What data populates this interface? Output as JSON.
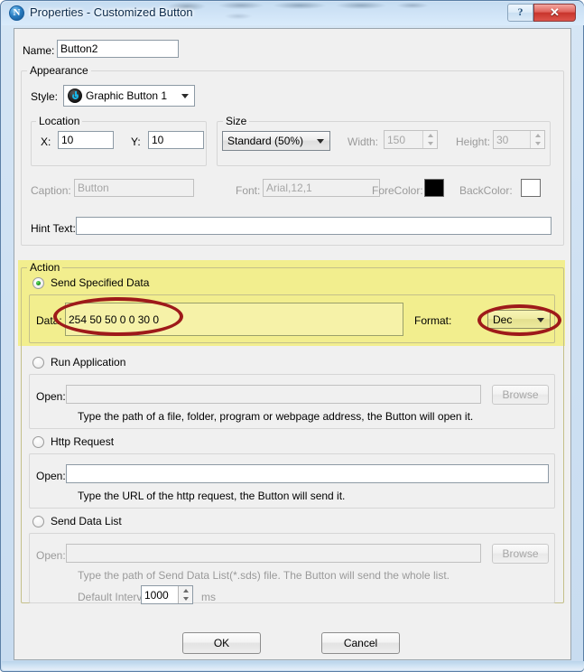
{
  "window": {
    "title": "Properties - Customized Button",
    "icon": "app-n-icon",
    "help_label": "?",
    "close_label": "✕"
  },
  "name_field": {
    "label": "Name:",
    "value": "Button2"
  },
  "appearance": {
    "title": "Appearance",
    "style": {
      "label": "Style:",
      "value": "Graphic Button 1",
      "icon": "power-button-icon"
    },
    "location": {
      "title": "Location",
      "x_label": "X:",
      "x_value": "10",
      "y_label": "Y:",
      "y_value": "10"
    },
    "size": {
      "title": "Size",
      "preset_value": "Standard   (50%)",
      "width_label": "Width:",
      "width_value": "150",
      "height_label": "Height:",
      "height_value": "30"
    },
    "caption": {
      "label": "Caption:",
      "value": "Button"
    },
    "font": {
      "label": "Font:",
      "value": "Arial,12,1"
    },
    "forecolor": {
      "label": "ForeColor:",
      "color": "#000000"
    },
    "backcolor": {
      "label": "BackColor:",
      "color": "#ffffff"
    },
    "hint": {
      "label": "Hint Text:",
      "value": ""
    }
  },
  "action": {
    "title": "Action",
    "highlight_color": "#f2ee8e",
    "annotation_color": "#9e1a1a",
    "send_specified_data": {
      "radio_label": "Send Specified Data",
      "selected": true,
      "data_label": "Data:",
      "data_value": "254 50 50 0 0 30 0",
      "format_label": "Format:",
      "format_value": "Dec"
    },
    "run_application": {
      "radio_label": "Run Application",
      "selected": false,
      "open_label": "Open:",
      "open_value": "",
      "browse_label": "Browse",
      "hint": "Type the path of a file, folder, program or webpage address, the Button will open it."
    },
    "http_request": {
      "radio_label": "Http Request",
      "selected": false,
      "open_label": "Open:",
      "open_value": "",
      "hint": "Type the URL of the http request, the Button will send it."
    },
    "send_data_list": {
      "radio_label": "Send Data List",
      "selected": false,
      "open_label": "Open:",
      "open_value": "",
      "browse_label": "Browse",
      "hint": "Type the path of Send Data List(*.sds) file. The Button will send the whole list.",
      "interval_label": "Default Interval",
      "interval_value": "1000",
      "interval_unit": "ms"
    }
  },
  "footer": {
    "ok_label": "OK",
    "cancel_label": "Cancel"
  }
}
